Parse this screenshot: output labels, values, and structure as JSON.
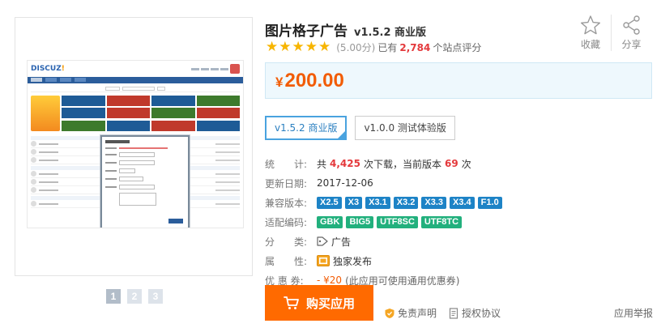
{
  "product": {
    "title": "图片格子广告",
    "version_edition": "v1.5.2 商业版"
  },
  "rating": {
    "stars": 5,
    "score_text": "(5.00分)",
    "prefix": "已有",
    "count": "2,784",
    "suffix": "个站点评分"
  },
  "actions": {
    "favorite_label": "收藏",
    "share_label": "分享"
  },
  "price": {
    "currency": "¥",
    "amount": "200.00"
  },
  "versions": [
    {
      "label": "v1.5.2 商业版",
      "active": true
    },
    {
      "label": "v1.0.0 测试体验版",
      "active": false
    }
  ],
  "stats": {
    "label": "统　　计:",
    "prefix": "共",
    "total_downloads": "4,425",
    "middle": "次下载，当前版本",
    "current_downloads": "69",
    "suffix": "次"
  },
  "updated": {
    "label": "更新日期:",
    "value": "2017-12-06"
  },
  "compat": {
    "label": "兼容版本:",
    "items": [
      "X2.5",
      "X3",
      "X3.1",
      "X3.2",
      "X3.3",
      "X3.4",
      "F1.0"
    ]
  },
  "encoding": {
    "label": "适配编码:",
    "items": [
      "GBK",
      "BIG5",
      "UTF8SC",
      "UTF8TC"
    ]
  },
  "category": {
    "label": "分　　类:",
    "value": "广告"
  },
  "attribute": {
    "label": "属　　性:",
    "value": "独家发布"
  },
  "coupon": {
    "label": "优 惠 券:",
    "value": "- ¥20",
    "note": "(此应用可使用通用优惠券)"
  },
  "buy": {
    "label": "购买应用"
  },
  "links": {
    "disclaimer": "免责声明",
    "license": "授权协议",
    "report": "应用举报"
  },
  "thumbs": [
    "1",
    "2",
    "3"
  ],
  "colors": {
    "price": "#f25c05",
    "accent_blue": "#4aa3df",
    "badge_blue": "#1d83c6",
    "badge_green": "#22b07d",
    "buy_button": "#ff6a00",
    "star": "#f7b500"
  }
}
